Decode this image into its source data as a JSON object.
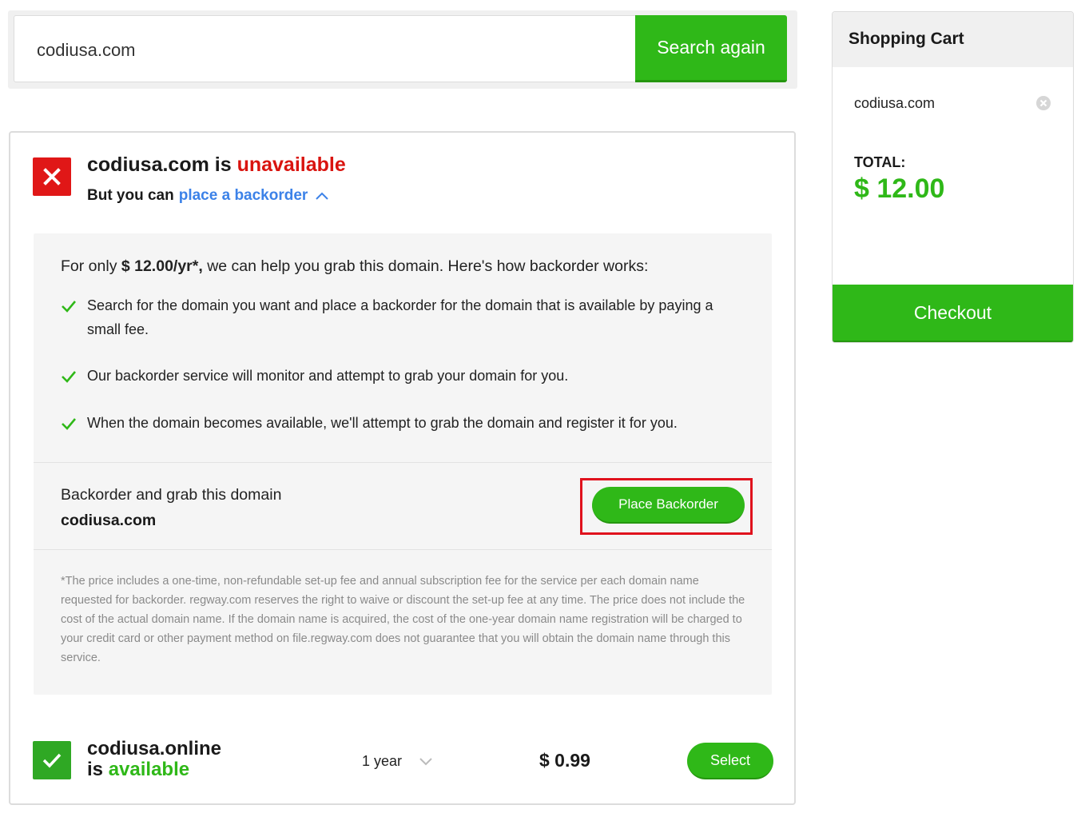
{
  "search": {
    "value": "codiusa.com",
    "button_label": "Search again"
  },
  "result_unavailable": {
    "domain": "codiusa.com",
    "is_text": " is ",
    "status": "unavailable",
    "sub_prefix": "But you can",
    "sub_link": "place a backorder"
  },
  "backorder": {
    "intro_prefix": "For only ",
    "intro_price": "$ 12.00/yr*,",
    "intro_suffix": " we can help you grab this domain. Here's how backorder works:",
    "steps": [
      "Search for the domain you want and place a backorder for the domain that is available by paying a small fee.",
      "Our backorder service will monitor and attempt to grab your domain for you.",
      "When the domain becomes available, we'll attempt to grab the domain and register it for you."
    ],
    "grab_label": "Backorder and grab this domain",
    "grab_domain": "codiusa.com",
    "place_button": "Place Backorder",
    "footnote": "*The price includes a one-time, non-refundable set-up fee and annual subscription fee for the service per each domain name requested for backorder. regway.com reserves the right to waive or discount the set-up fee at any time. The price does not include the cost of the actual domain name. If the domain name is acquired, the cost of the one-year domain name registration will be charged to your credit card or other payment method on file.regway.com does not guarantee that you will obtain the domain name through this service."
  },
  "result_available": {
    "domain": "codiusa.online",
    "is_text": "is ",
    "status": "available",
    "term": "1 year",
    "price": "$ 0.99",
    "select_button": "Select"
  },
  "cart": {
    "title": "Shopping Cart",
    "items": [
      "codiusa.com"
    ],
    "total_label": "TOTAL:",
    "total_value": "$ 12.00",
    "checkout_button": "Checkout"
  },
  "colors": {
    "green": "#2fb818",
    "red": "#d9140f",
    "link_blue": "#3c82e8"
  }
}
